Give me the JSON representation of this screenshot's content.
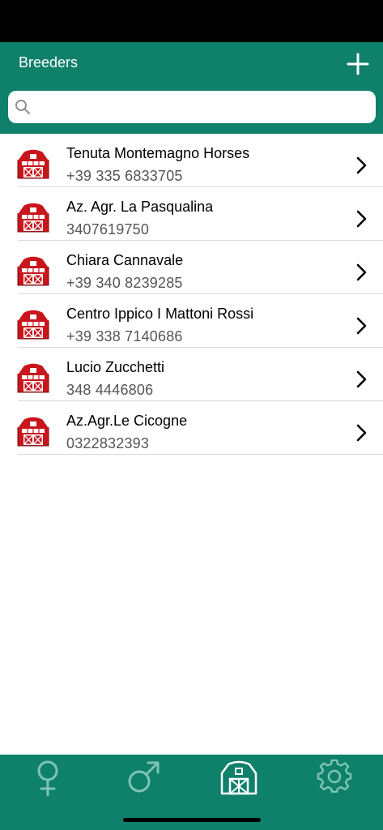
{
  "nav": {
    "title": "Breeders",
    "add_icon": "plus-icon"
  },
  "search": {
    "placeholder": "",
    "value": ""
  },
  "breeders": [
    {
      "name": "Tenuta Montemagno Horses",
      "phone": "+39 335 6833705"
    },
    {
      "name": "Az. Agr. La Pasqualina",
      "phone": "3407619750"
    },
    {
      "name": "Chiara Cannavale",
      "phone": "+39 340 8239285"
    },
    {
      "name": "Centro Ippico I Mattoni Rossi",
      "phone": "+39 338 7140686"
    },
    {
      "name": "Lucio Zucchetti",
      "phone": "348 4446806"
    },
    {
      "name": "Az.Agr.Le Cicogne",
      "phone": "0322832393"
    }
  ],
  "tabs": [
    {
      "icon": "female-icon",
      "selected": false
    },
    {
      "icon": "male-icon",
      "selected": false
    },
    {
      "icon": "barn-icon",
      "selected": true
    },
    {
      "icon": "gear-icon",
      "selected": false
    }
  ],
  "colors": {
    "brand": "#0f806a",
    "inactive_tab": "#7dc4b3",
    "active_tab": "#ffffff",
    "barn_red": "#c8161c"
  }
}
